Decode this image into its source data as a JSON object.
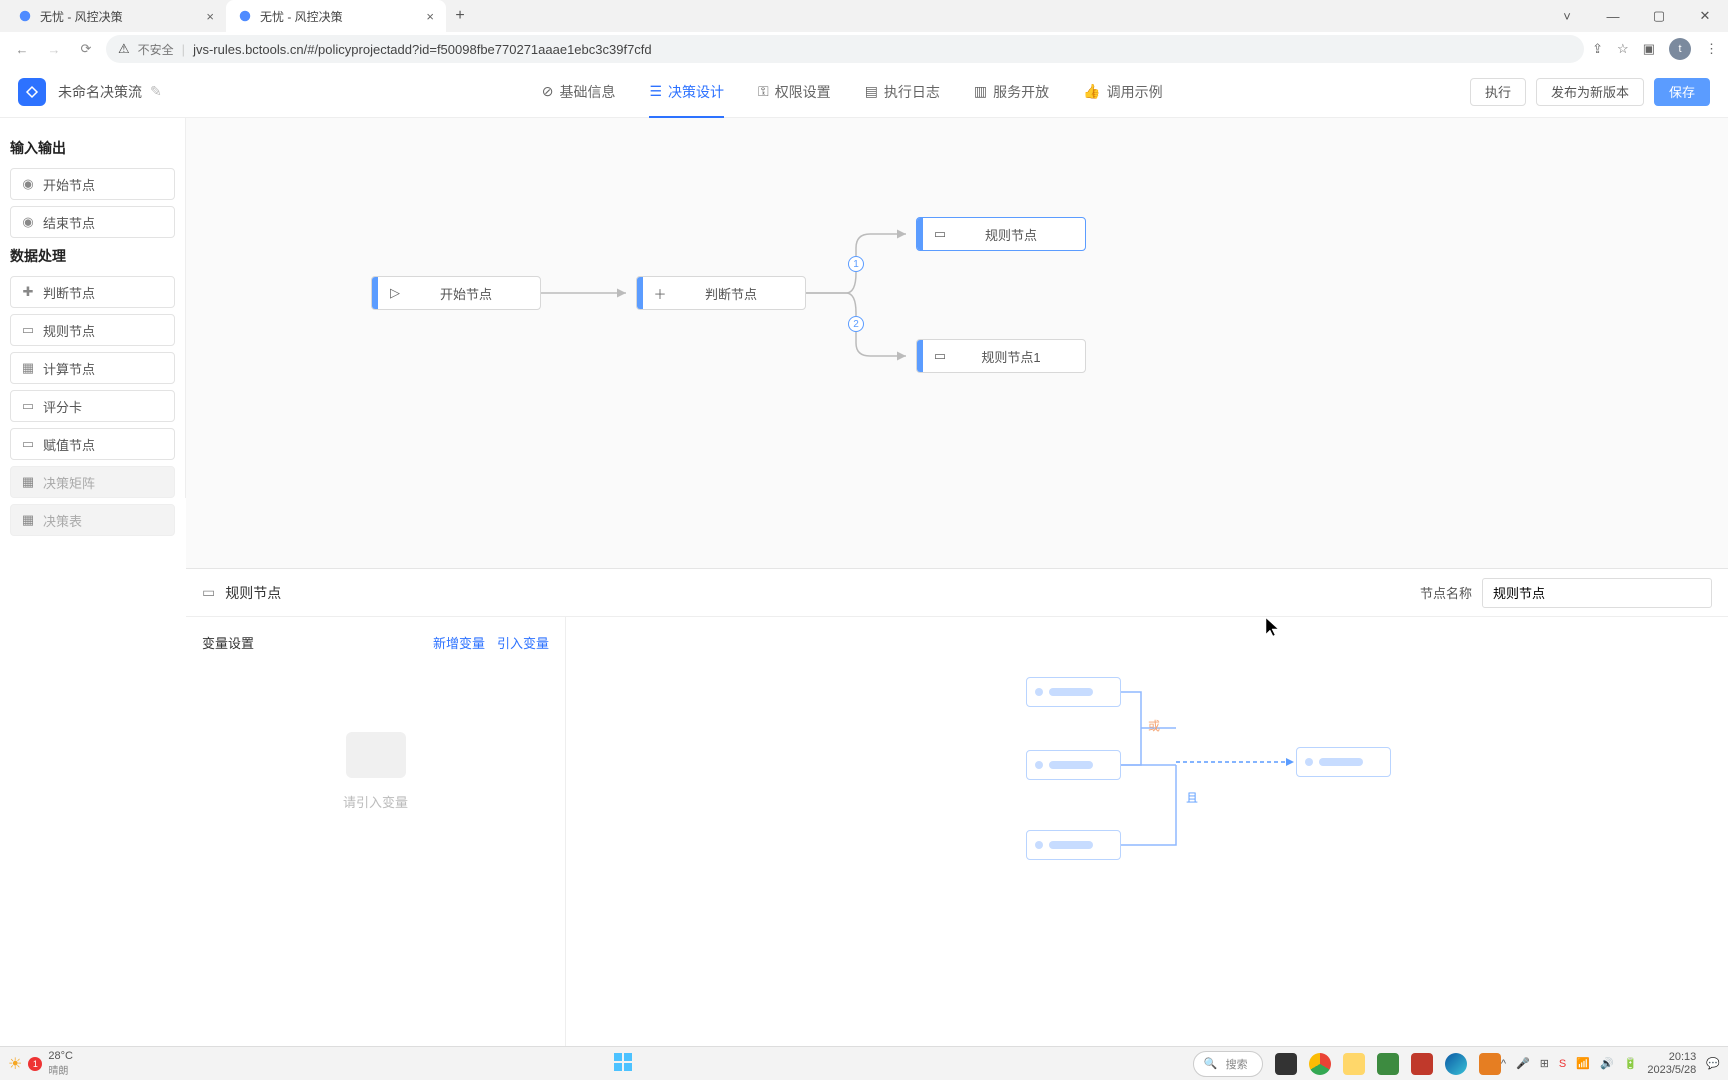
{
  "browser": {
    "tabs": [
      {
        "title": "无忧 - 风控决策"
      },
      {
        "title": "无忧 - 风控决策"
      }
    ],
    "insecure_label": "不安全",
    "url": "jvs-rules.bctools.cn/#/policyprojectadd?id=f50098fbe770271aaae1ebc3c39f7cfd",
    "avatar_initial": "t"
  },
  "app": {
    "doc_title": "未命名决策流",
    "nav": {
      "basic": "基础信息",
      "design": "决策设计",
      "perm": "权限设置",
      "log": "执行日志",
      "service": "服务开放",
      "invoke": "调用示例"
    },
    "actions": {
      "execute": "执行",
      "publish": "发布为新版本",
      "save": "保存"
    }
  },
  "palette": {
    "io_header": "输入输出",
    "start_node": "开始节点",
    "end_node": "结束节点",
    "data_header": "数据处理",
    "decision_node": "判断节点",
    "rule_node": "规则节点",
    "calc_node": "计算节点",
    "score_node": "评分卡",
    "assign_node": "赋值节点",
    "matrix_node": "决策矩阵",
    "table_node": "决策表"
  },
  "flow": {
    "start": "开始节点",
    "decision": "判断节点",
    "rule_a": "规则节点",
    "rule_b": "规则节点1",
    "badge1": "1",
    "badge2": "2"
  },
  "panel": {
    "title": "规则节点",
    "node_name_label": "节点名称",
    "node_name_value": "规则节点",
    "vars_title": "变量设置",
    "add_var": "新增变量",
    "import_var": "引入变量",
    "empty_text": "请引入变量",
    "op_or": "或",
    "op_and": "且"
  },
  "taskbar": {
    "temp": "28°C",
    "weather": "晴朗",
    "badge": "1",
    "search_placeholder": "搜索",
    "time": "20:13",
    "date": "2023/5/28"
  }
}
